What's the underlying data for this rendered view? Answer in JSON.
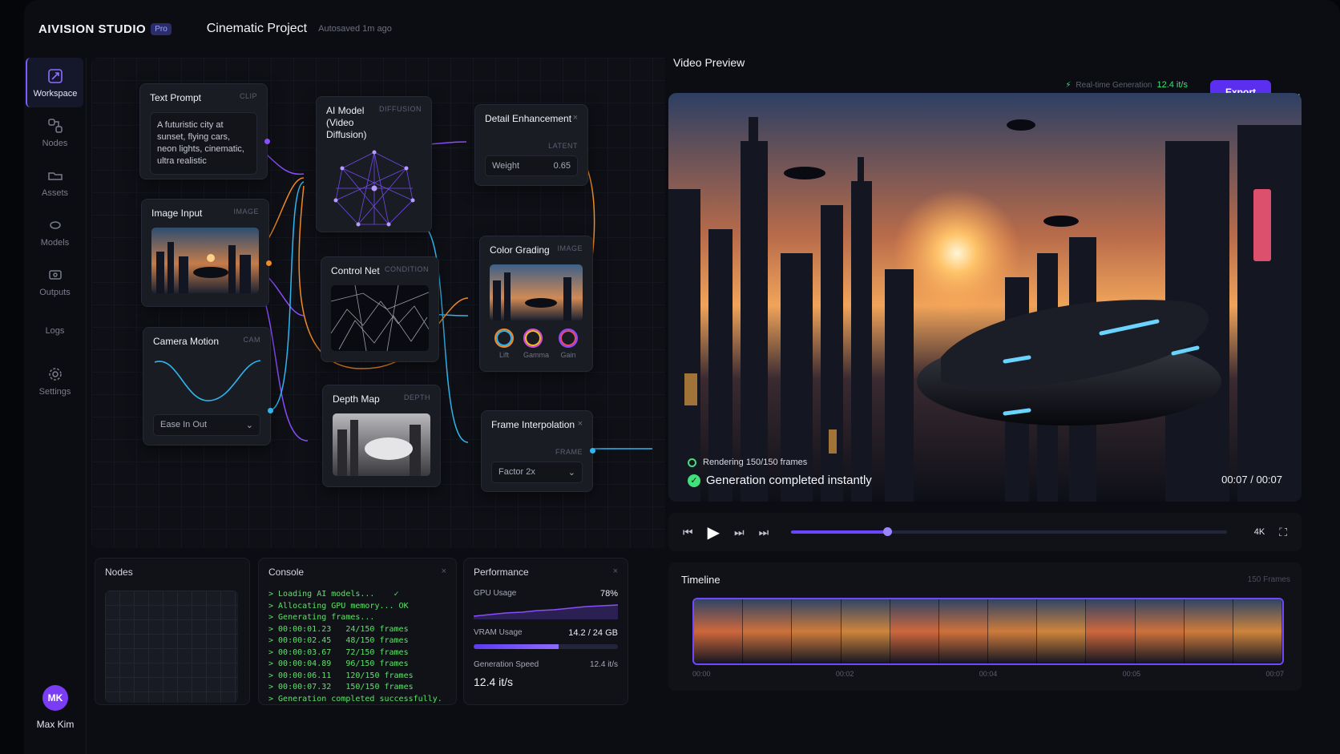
{
  "app": {
    "brand": "AIVISION STUDIO",
    "badge": "Pro",
    "project": "Cinematic Project",
    "autosave": "Autosaved 1m ago"
  },
  "sidebar": {
    "items": [
      {
        "label": "Workspace",
        "icon": "workspace-icon",
        "active": true
      },
      {
        "label": "Nodes",
        "icon": "nodes-icon"
      },
      {
        "label": "Assets",
        "icon": "assets-icon"
      },
      {
        "label": "Models",
        "icon": "models-icon"
      },
      {
        "label": "Outputs",
        "icon": "outputs-icon"
      },
      {
        "label": "Logs",
        "icon": "logs-icon"
      },
      {
        "label": "Settings",
        "icon": "settings-icon"
      }
    ],
    "user": {
      "initials": "MK",
      "name": "Max Kim"
    }
  },
  "nodes": {
    "text_prompt": {
      "title": "Text Prompt",
      "tag": "CLIP",
      "text": "A futuristic city at sunset, flying cars, neon lights, cinematic, ultra realistic"
    },
    "image_input": {
      "title": "Image Input",
      "tag": "IMAGE"
    },
    "camera_motion": {
      "title": "Camera Motion",
      "tag": "CAM",
      "easing": "Ease In Out"
    },
    "ai_model": {
      "title": "AI Model",
      "subtitle": "(Video Diffusion)",
      "tag": "DIFFUSION"
    },
    "control_net": {
      "title": "Control Net",
      "tag": "CONDITION"
    },
    "depth_map": {
      "title": "Depth Map",
      "tag": "DEPTH"
    },
    "detail_enhancement": {
      "title": "Detail Enhancement",
      "tag": "LATENT",
      "param_label": "Weight",
      "param_value": "0.65"
    },
    "color_grading": {
      "title": "Color Grading",
      "tag": "IMAGE",
      "wheels": [
        "Lift",
        "Gamma",
        "Gain"
      ]
    },
    "frame_interpolation": {
      "title": "Frame Interpolation",
      "tag": "FRAME",
      "factor": "Factor 2x"
    }
  },
  "panels": {
    "nodes_title": "Nodes",
    "console": {
      "title": "Console",
      "lines": [
        "> Loading AI models...    ✓",
        "> Allocating GPU memory... OK",
        "> Generating frames...",
        "> 00:00:01.23   24/150 frames",
        "> 00:00:02.45   48/150 frames",
        "> 00:00:03.67   72/150 frames",
        "> 00:00:04.89   96/150 frames",
        "> 00:00:06.11   120/150 frames",
        "> 00:00:07.32   150/150 frames",
        "> Generation completed successfully."
      ]
    },
    "performance": {
      "title": "Performance",
      "gpu_label": "GPU Usage",
      "gpu_value": "78%",
      "gpu_fraction": 0.78,
      "vram_label": "VRAM Usage",
      "vram_value": "14.2 / 24 GB",
      "vram_fraction": 0.59,
      "speed_label": "Generation Speed",
      "speed_small": "12.4 it/s",
      "speed_value": "12.4 it/s"
    }
  },
  "preview": {
    "title": "Video Preview",
    "realtime_label": "Real-time Generation",
    "realtime_speed": "12.4 it/s",
    "export_label": "Export",
    "more_label": "...",
    "render_status": "Rendering 150/150 frames",
    "done_status": "Generation completed instantly",
    "timecode": "00:07 / 00:07",
    "quality": "4K",
    "progress_fraction": 0.22
  },
  "timeline": {
    "title": "Timeline",
    "frame_count": "150 Frames",
    "ticks": [
      "00:00",
      "00:02",
      "00:04",
      "00:05",
      "00:07"
    ]
  },
  "colors": {
    "accent": "#6a45ff",
    "success": "#41e07a",
    "wire_purple": "#8a4dff",
    "wire_orange": "#f08a24",
    "wire_blue": "#2fb6f0"
  }
}
